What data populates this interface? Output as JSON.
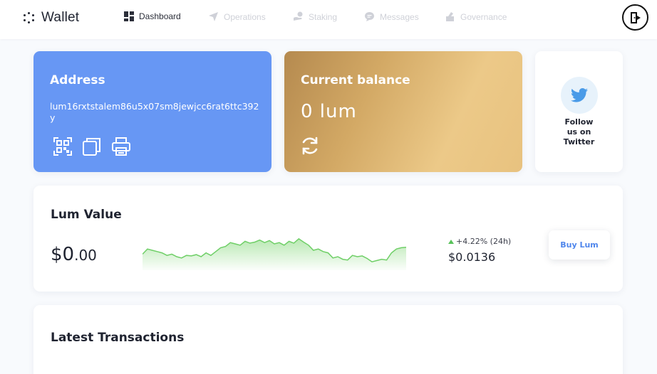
{
  "app": {
    "name": "Wallet"
  },
  "nav": {
    "items": [
      {
        "label": "Dashboard",
        "icon": "dashboard-grid-icon",
        "active": true
      },
      {
        "label": "Operations",
        "icon": "paper-plane-icon",
        "active": false
      },
      {
        "label": "Staking",
        "icon": "coins-hand-icon",
        "active": false
      },
      {
        "label": "Messages",
        "icon": "chat-bubble-icon",
        "active": false
      },
      {
        "label": "Governance",
        "icon": "vote-box-icon",
        "active": false
      }
    ],
    "logout_icon": "logout-door-icon"
  },
  "address_card": {
    "title": "Address",
    "address": "lum16rxtstalem86u5x07sm8jewjcc6rat6ttc392y",
    "actions": [
      "qr-code-icon",
      "copy-icon",
      "print-icon"
    ]
  },
  "balance_card": {
    "title": "Current balance",
    "amount": "0 lum",
    "refresh_icon": "refresh-icon"
  },
  "twitter_card": {
    "label": "Follow us on Twitter",
    "icon": "twitter-bird-icon"
  },
  "lum_value": {
    "title": "Lum Value",
    "price_whole": "$0",
    "price_cents": ".00",
    "change": "+4.22% (24h)",
    "current_price": "$0.0136",
    "buy_label": "Buy Lum",
    "trend_values": [
      0.35,
      0.55,
      0.5,
      0.45,
      0.4,
      0.3,
      0.35,
      0.25,
      0.2,
      0.3,
      0.28,
      0.33,
      0.25,
      0.4,
      0.3,
      0.45,
      0.6,
      0.65,
      0.8,
      0.75,
      0.7,
      0.85,
      0.78,
      0.82,
      0.9,
      0.8,
      0.88,
      0.75,
      0.8,
      0.7,
      0.85,
      0.78,
      0.95,
      0.82,
      0.7,
      0.5,
      0.55,
      0.45,
      0.4,
      0.2,
      0.25,
      0.15,
      0.12,
      0.3,
      0.25,
      0.28,
      0.18,
      0.05,
      0.1,
      0.15,
      0.12,
      0.4,
      0.55,
      0.6,
      0.62
    ]
  },
  "transactions": {
    "title": "Latest Transactions"
  },
  "colors": {
    "accent_blue": "#6797f4",
    "gold_start": "#b58a4f",
    "gold_end": "#ecc988",
    "chart_green": "#6fcf67",
    "buy_text": "#4f86ec"
  }
}
